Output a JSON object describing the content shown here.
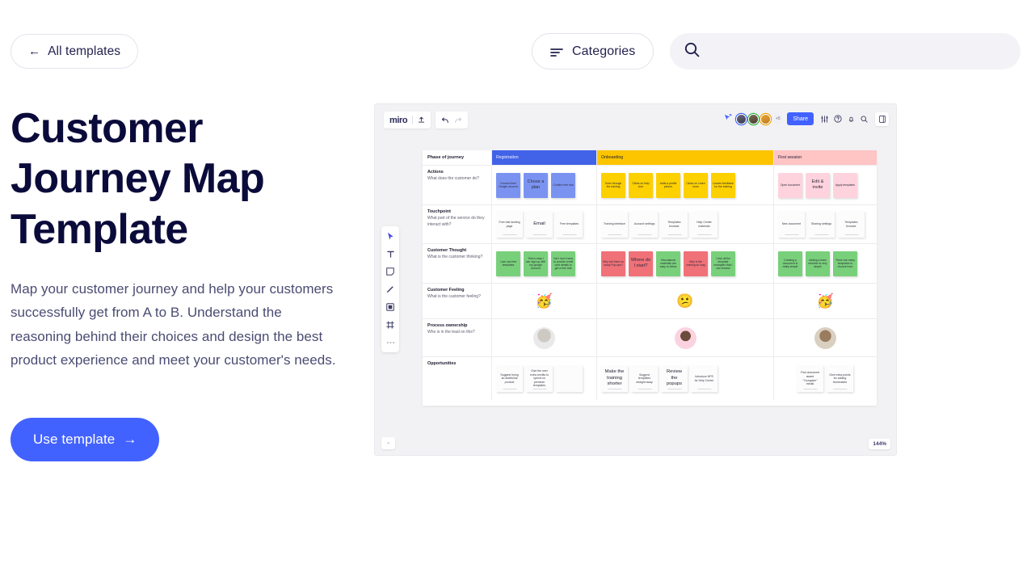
{
  "header": {
    "back_button": {
      "arrow": "←",
      "label": "All templates"
    },
    "categories_button": {
      "label": "Categories",
      "icon": "filter-lines-icon"
    },
    "search": {
      "value": "",
      "placeholder": "",
      "icon": "search-icon"
    }
  },
  "hero": {
    "title": "Customer Journey Map Template",
    "description": "Map your customer journey and help your customers successfully get from A to B. Understand the reasoning behind their choices and design the best product experience and meet your customer's needs.",
    "cta_label": "Use template",
    "cta_arrow": "→",
    "cta_color": "#4262ff",
    "title_color": "#0b0b3b"
  },
  "board": {
    "logo": "miro",
    "upload_icon": "upload-icon",
    "undo_icon": "undo-icon",
    "redo_icon": "redo-icon",
    "share_label": "Share",
    "collaborator_overflow": "+5",
    "right_icons": [
      "cursor-share-icon",
      "tune-icon",
      "help-circle-icon",
      "bell-icon",
      "search-icon",
      "panel-toggle-icon"
    ],
    "left_tools": [
      "cursor-icon",
      "text-icon",
      "sticky-note-icon",
      "pen-icon",
      "shapes-icon",
      "frame-icon",
      "more-icon"
    ],
    "zoom_level": "144%",
    "collapse_icon": "»"
  },
  "chart_data": {
    "type": "table",
    "title": "Customer Journey Map",
    "phase_header_label": "Phase of journey",
    "phases": [
      {
        "label": "Registration",
        "color": "#4262e8"
      },
      {
        "label": "Onboarding",
        "color": "#fdc500"
      },
      {
        "label": "First session",
        "color": "#ffc4c4"
      }
    ],
    "rows": [
      {
        "title": "Actions",
        "subtitle": "What does the customer do?",
        "cells": [
          [
            {
              "text": "Connect their Google account",
              "color": "blue"
            },
            {
              "text": "Chose a plan",
              "color": "blue",
              "big": true
            },
            {
              "text": "Confirm free trial",
              "color": "blue"
            }
          ],
          [
            {
              "text": "Goes through the training",
              "color": "yellow"
            },
            {
              "text": "Clicks on help icon",
              "color": "yellow"
            },
            {
              "text": "Adds a profile picture",
              "color": "yellow"
            },
            {
              "text": "Clicks on Learn more",
              "color": "yellow"
            },
            {
              "text": "Leaves feedback for the training",
              "color": "yellow"
            }
          ],
          [
            {
              "text": "Open document",
              "color": "pink"
            },
            {
              "text": "Edit & invite",
              "color": "pink",
              "big": true
            },
            {
              "text": "Apply templates",
              "color": "pink"
            }
          ]
        ]
      },
      {
        "title": "Touchpoint",
        "subtitle": "What part of the service do they interact with?",
        "cells": [
          [
            {
              "text": "Free trial landing page",
              "color": "card"
            },
            {
              "text": "Email",
              "color": "card",
              "big": true
            },
            {
              "text": "Free templates",
              "color": "card"
            }
          ],
          [
            {
              "text": "Training interface",
              "color": "card"
            },
            {
              "text": "Account settings",
              "color": "card"
            },
            {
              "text": "Templates browser",
              "color": "card"
            },
            {
              "text": "Help Center materials",
              "color": "card"
            }
          ],
          [
            {
              "text": "New document",
              "color": "card"
            },
            {
              "text": "Sharing settings",
              "color": "card"
            },
            {
              "text": "Templates browser",
              "color": "card"
            }
          ]
        ]
      },
      {
        "title": "Customer Thought",
        "subtitle": "What is the customer thinking?",
        "cells": [
          [
            {
              "text": "I can use free templates",
              "color": "green"
            },
            {
              "text": "This is easy I can sign up with my google account",
              "color": "green"
            },
            {
              "text": "Get I don't need to provide credit card details to get a free trial",
              "color": "green"
            }
          ],
          [
            {
              "text": "Why are there so many Pop-ups?",
              "color": "red"
            },
            {
              "text": "Where do I start?",
              "color": "red",
              "big": true
            },
            {
              "text": "Educational materials are easy to follow",
              "color": "green"
            },
            {
              "text": "Why is the training so long",
              "color": "red"
            },
            {
              "text": "I love all the template examples that I can browse",
              "color": "green"
            }
          ],
          [
            {
              "text": "Creating a document is really simple",
              "color": "green"
            },
            {
              "text": "Adding a team member is very simple",
              "color": "green"
            },
            {
              "text": "There are many templates to choose from",
              "color": "green"
            }
          ]
        ]
      },
      {
        "title": "Customer Feeling",
        "subtitle": "What is the customer feeling?",
        "emojis": [
          "🥳",
          "😕",
          "🥳"
        ]
      },
      {
        "title": "Process ownership",
        "subtitle": "Who is in the lead on this?",
        "avatars": [
          "avatar-grey",
          "avatar-pink",
          "avatar-tan"
        ]
      },
      {
        "title": "Opportunities",
        "subtitle": "",
        "cells": [
          [
            {
              "text": "Suggest trying an additional product",
              "color": "card"
            },
            {
              "text": "Give the user extra credits to spend on premium templates",
              "color": "card"
            },
            {
              "text": "",
              "color": "card",
              "nobar": true
            }
          ],
          [
            {
              "text": "Make the training shorter",
              "color": "card",
              "big": true
            },
            {
              "text": "Suggest templates straight away",
              "color": "card"
            },
            {
              "text": "Review the popups",
              "color": "card",
              "big": true
            },
            {
              "text": "Introduce NPS for Help Center",
              "color": "card"
            }
          ],
          [
            {
              "text": "First document award \"Youngster\" medal",
              "color": "card"
            },
            {
              "text": "Give extra points for adding teammates",
              "color": "card"
            }
          ]
        ]
      }
    ]
  }
}
